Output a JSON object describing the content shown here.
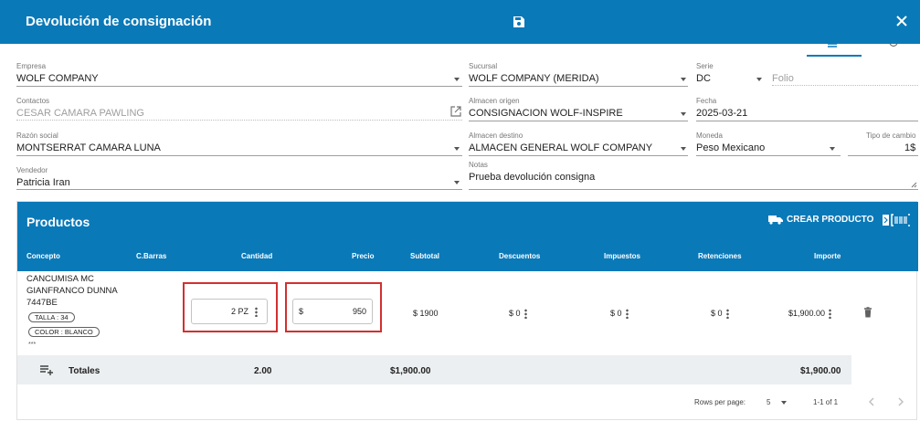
{
  "dialog": {
    "title": "Devolución de consignación",
    "save_icon": "save-icon",
    "close_icon": "close-icon"
  },
  "form": {
    "empresa": {
      "label": "Empresa",
      "value": "WOLF COMPANY"
    },
    "sucursal": {
      "label": "Sucursal",
      "value": "WOLF COMPANY (MERIDA)"
    },
    "serie": {
      "label": "Serie",
      "value": "DC"
    },
    "folio": {
      "placeholder": "Folio"
    },
    "contactos": {
      "label": "Contactos",
      "value": "CESAR CAMARA PAWLING"
    },
    "almacen_origen": {
      "label": "Almacen origen",
      "value": "CONSIGNACION WOLF-INSPIRE"
    },
    "fecha": {
      "label": "Fecha",
      "value": "2025-03-21"
    },
    "razon_social": {
      "label": "Razón social",
      "value": "MONTSERRAT CAMARA LUNA"
    },
    "almacen_destino": {
      "label": "Almacen destino",
      "value": "ALMACEN GENERAL WOLF COMPANY"
    },
    "moneda": {
      "label": "Moneda",
      "value": "Peso Mexicano"
    },
    "tipo_cambio": {
      "label": "Tipo de cambio",
      "value": "1$"
    },
    "vendedor": {
      "label": "Vendedor",
      "value": "Patricia Iran"
    },
    "notas": {
      "label": "Notas",
      "value": "Prueba devolución consigna"
    }
  },
  "products": {
    "title": "Productos",
    "crear_label": "CREAR PRODUCTO",
    "columns": {
      "concepto": "Concepto",
      "cbarras": "C.Barras",
      "cantidad": "Cantidad",
      "precio": "Precio",
      "subtotal": "Subtotal",
      "descuentos": "Descuentos",
      "impuestos": "Impuestos",
      "retenciones": "Retenciones",
      "importe": "Importe"
    },
    "rows": [
      {
        "concepto_lines": [
          "CANCUMISA MC",
          "GIANFRANCO DUNNA",
          "7447BE"
        ],
        "chips": [
          "TALLA : 34",
          "COLOR : BLANCO"
        ],
        "more": "***",
        "cantidad": "2 PZ",
        "precio_prefix": "$",
        "precio": "950",
        "subtotal": "$ 1900",
        "descuentos": "$ 0",
        "impuestos": "$ 0",
        "retenciones": "$ 0",
        "importe": "$1,900.00"
      }
    ],
    "totals": {
      "label": "Totales",
      "cantidad": "2.00",
      "precio": "$1,900.00",
      "importe": "$1,900.00"
    },
    "footer": {
      "rows_per_page_label": "Rows per page:",
      "rows_per_page_value": "5",
      "range": "1-1 of 1"
    }
  }
}
